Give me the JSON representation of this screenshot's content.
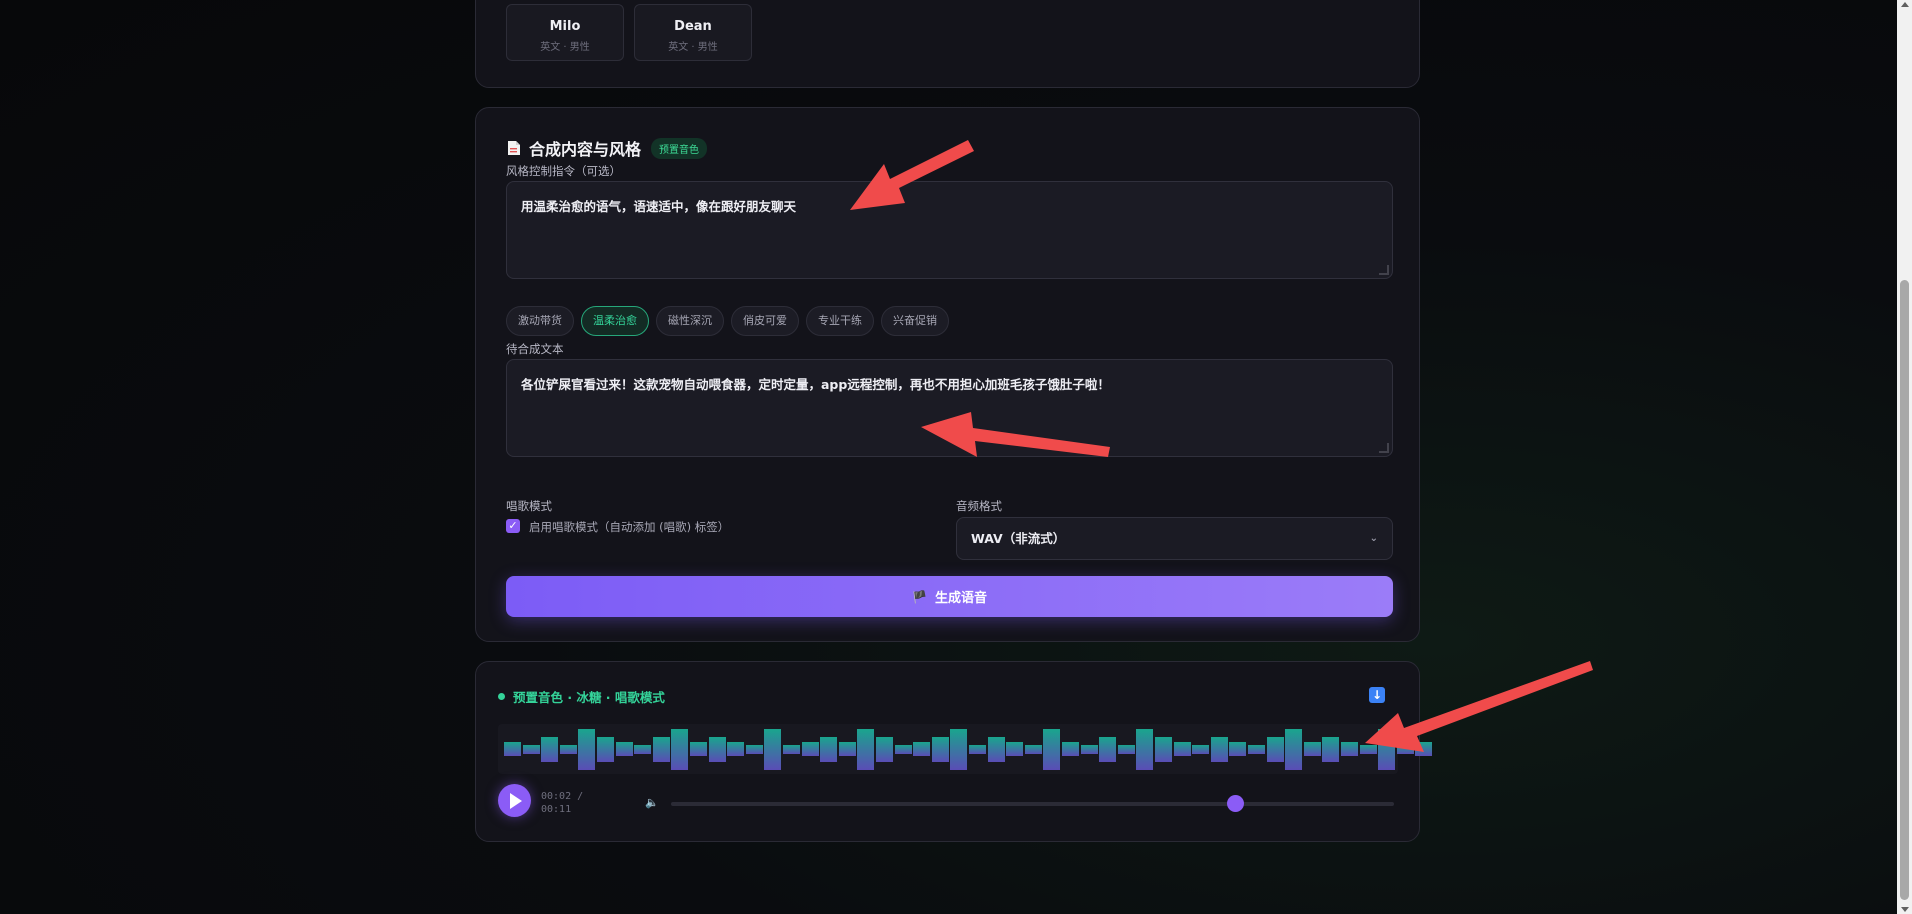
{
  "voices": [
    {
      "name": "Milo",
      "meta": "英文 · 男性"
    },
    {
      "name": "Dean",
      "meta": "英文 · 男性"
    }
  ],
  "synth": {
    "title": "合成内容与风格",
    "badge": "预置音色",
    "style_label": "风格控制指令（可选）",
    "style_value": "用温柔治愈的语气，语速适中，像在跟好朋友聊天",
    "style_chips": [
      "激动带货",
      "温柔治愈",
      "磁性深沉",
      "俏皮可爱",
      "专业干练",
      "兴奋促销"
    ],
    "active_chip": "温柔治愈",
    "text_label": "待合成文本",
    "text_value": "各位铲屎官看过来！这款宠物自动喂食器，定时定量，app远程控制，再也不用担心加班毛孩子饿肚子啦！",
    "sing_label": "唱歌模式",
    "sing_checkbox_label": "启用唱歌模式（自动添加 (唱歌) 标签）",
    "sing_checked": true,
    "format_label": "音频格式",
    "format_value": "WAV（非流式）",
    "generate_label": "生成语音"
  },
  "player": {
    "header": "预置音色 · 冰糖 · 唱歌模式",
    "time_current": "00:02",
    "time_sep": " /",
    "time_total": "00:11",
    "volume_level": 0.78,
    "waveform_levels": [
      0.3,
      0.2,
      0.55,
      0.2,
      0.9,
      0.55,
      0.3,
      0.2,
      0.55,
      0.9,
      0.3,
      0.55,
      0.3,
      0.2,
      0.9,
      0.2,
      0.3,
      0.55,
      0.3,
      0.9,
      0.55,
      0.2,
      0.3,
      0.55,
      0.9,
      0.2,
      0.55,
      0.3,
      0.2,
      0.9,
      0.3,
      0.2,
      0.55,
      0.2,
      0.9,
      0.55,
      0.3,
      0.2,
      0.55,
      0.3,
      0.2,
      0.55,
      0.9,
      0.3,
      0.55,
      0.3,
      0.2,
      0.9,
      0.2,
      0.3
    ]
  },
  "colors": {
    "accent": "#8b5cf6",
    "success": "#34d399",
    "annotation_arrow": "#f04b4b"
  }
}
